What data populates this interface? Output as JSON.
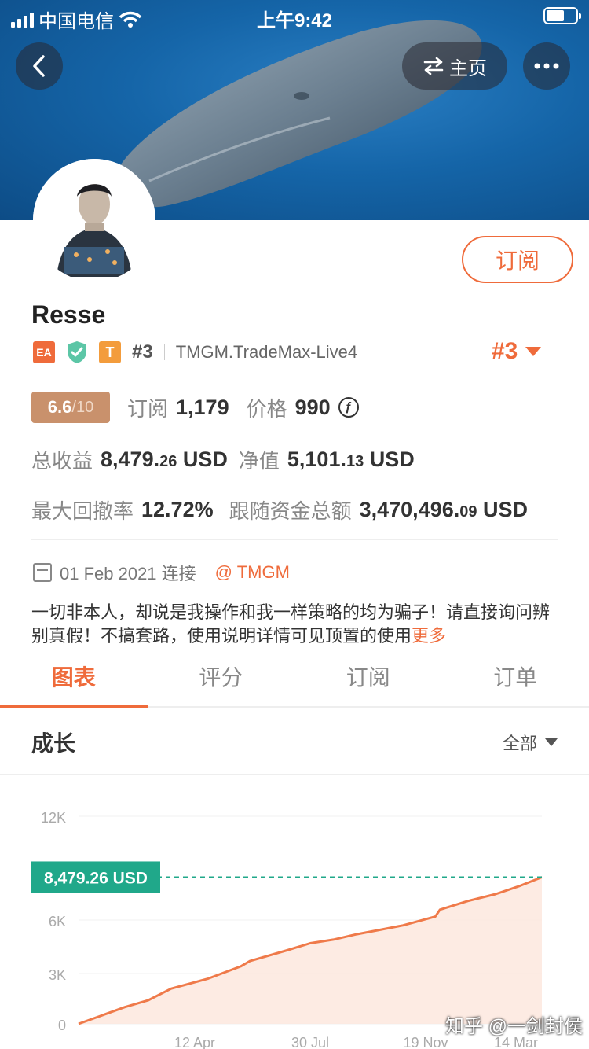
{
  "status_bar": {
    "carrier": "中国电信",
    "time": "上午9:42"
  },
  "nav": {
    "home_label": "主页"
  },
  "profile": {
    "username": "Resse",
    "subscribe_label": "订阅",
    "tag_ea": "EA",
    "tag_t": "T",
    "rank_small": "#3",
    "broker": "TMGM.TradeMax-Live4",
    "rank_big": "#3"
  },
  "stats": {
    "score": "6.6",
    "score_den": "/10",
    "subscribe_label": "订阅",
    "subscribe_count": "1,179",
    "price_label": "价格",
    "price_value": "990",
    "coin_symbol": "ƒ",
    "total_profit_label": "总收益",
    "total_profit_int": "8,479.",
    "total_profit_dec": "26",
    "total_profit_unit": "USD",
    "equity_label": "净值",
    "equity_int": "5,101.",
    "equity_dec": "13",
    "equity_unit": "USD",
    "drawdown_label": "最大回撤率",
    "drawdown_value": "12.72%",
    "follow_label": "跟随资金总额",
    "follow_int": "3,470,496.",
    "follow_dec": "09",
    "follow_unit": "USD"
  },
  "connection": {
    "date_text": "01 Feb 2021 连接",
    "broker_tag": "@ TMGM"
  },
  "bio": {
    "text": "一切非本人，却说是我操作和我一样策略的均为骗子！请直接询问辨别真假！不搞套路，使用说明详情可见顶置的使用",
    "more": "更多"
  },
  "tabs": [
    {
      "label": "图表",
      "active": true
    },
    {
      "label": "评分",
      "active": false
    },
    {
      "label": "订阅",
      "active": false
    },
    {
      "label": "订单",
      "active": false
    }
  ],
  "growth": {
    "title": "成长",
    "range": "全部"
  },
  "chart_data": {
    "type": "area",
    "y_ticks": [
      "12K",
      "6K",
      "3K",
      "0"
    ],
    "x_ticks": [
      "12 Apr",
      "30 Jul",
      "19 Nov",
      "14 Mar"
    ],
    "ylim": [
      0,
      12000
    ],
    "current_label": "8,479.26 USD",
    "current_value": 8479.26,
    "series": [
      {
        "x": 0.0,
        "y": 0
      },
      {
        "x": 0.04,
        "y": 400
      },
      {
        "x": 0.1,
        "y": 1000
      },
      {
        "x": 0.15,
        "y": 1400
      },
      {
        "x": 0.2,
        "y": 2100
      },
      {
        "x": 0.28,
        "y": 2700
      },
      {
        "x": 0.35,
        "y": 3400
      },
      {
        "x": 0.37,
        "y": 3700
      },
      {
        "x": 0.45,
        "y": 4300
      },
      {
        "x": 0.5,
        "y": 4700
      },
      {
        "x": 0.55,
        "y": 4900
      },
      {
        "x": 0.6,
        "y": 5200
      },
      {
        "x": 0.65,
        "y": 5450
      },
      {
        "x": 0.7,
        "y": 5700
      },
      {
        "x": 0.77,
        "y": 6200
      },
      {
        "x": 0.78,
        "y": 6600
      },
      {
        "x": 0.84,
        "y": 7100
      },
      {
        "x": 0.9,
        "y": 7500
      },
      {
        "x": 0.95,
        "y": 7950
      },
      {
        "x": 1.0,
        "y": 8479.26
      }
    ],
    "line_color": "#ef7a4a",
    "fill_color": "#fde6dc",
    "marker_color": "#20a88a"
  }
}
